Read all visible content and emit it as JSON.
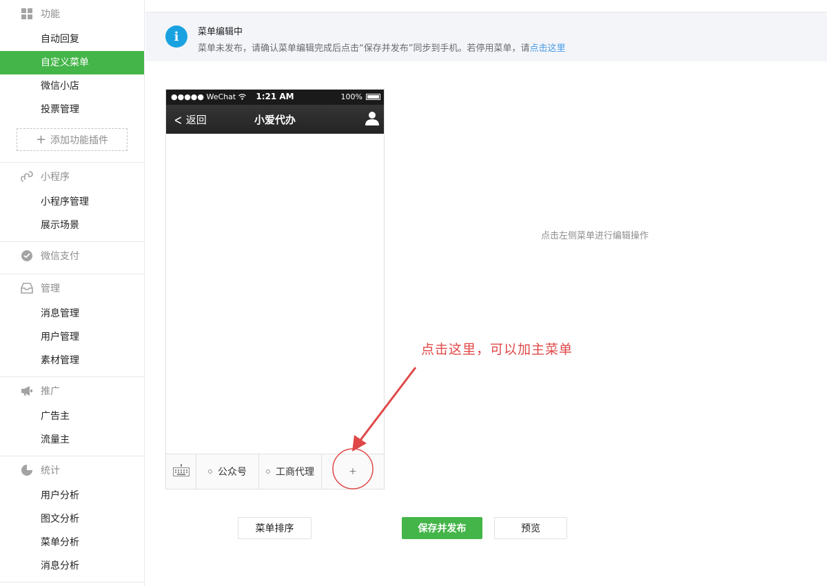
{
  "sidebar": {
    "sections": [
      {
        "title": "功能",
        "icon": "grid-icon",
        "items": [
          "自动回复",
          "自定义菜单",
          "微信小店",
          "投票管理"
        ],
        "active": 1,
        "add_plugin": "添加功能插件"
      },
      {
        "title": "小程序",
        "icon": "link-icon",
        "items": [
          "小程序管理",
          "展示场景"
        ]
      },
      {
        "title": "微信支付",
        "icon": "pay-icon",
        "items": []
      },
      {
        "title": "管理",
        "icon": "inbox-icon",
        "items": [
          "消息管理",
          "用户管理",
          "素材管理"
        ]
      },
      {
        "title": "推广",
        "icon": "megaphone-icon",
        "items": [
          "广告主",
          "流量主"
        ]
      },
      {
        "title": "统计",
        "icon": "pie-icon",
        "items": [
          "用户分析",
          "图文分析",
          "菜单分析",
          "消息分析"
        ]
      }
    ]
  },
  "notice": {
    "title": "菜单编辑中",
    "desc": "菜单未发布，请确认菜单编辑完成后点击“保存并发布”同步到手机。若停用菜单，请",
    "link": "点击这里"
  },
  "phone": {
    "status_left": "●●●●● WeChat",
    "status_time": "1:21 AM",
    "status_battery": "100%",
    "back_label": "返回",
    "title": "小爱代办",
    "menu_items": [
      "公众号",
      "工商代理"
    ],
    "add_symbol": "+"
  },
  "editor_hint": "点击左侧菜单进行编辑操作",
  "annotation": "点击这里，可以加主菜单",
  "buttons": {
    "sort": "菜单排序",
    "save_publish": "保存并发布",
    "preview": "预览"
  }
}
